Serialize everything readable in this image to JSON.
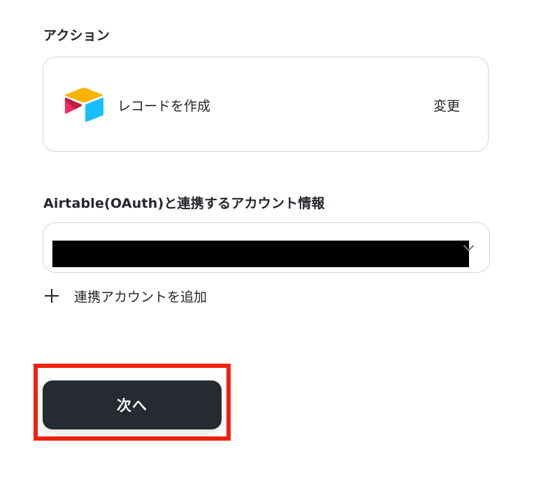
{
  "action_section": {
    "label": "アクション",
    "app_icon": "airtable-logo-icon",
    "action_name": "レコードを作成",
    "change_label": "変更"
  },
  "account_section": {
    "label": "Airtable(OAuth)と連携するアカウント情報",
    "selected_value_redacted": true,
    "add_account_label": "連携アカウントを追加"
  },
  "footer": {
    "next_label": "次へ"
  },
  "colors": {
    "button_bg": "#262a31",
    "highlight": "#f4200f",
    "logo_yellow": "#fcb400",
    "logo_blue": "#18bfff",
    "logo_red": "#f82b60"
  }
}
